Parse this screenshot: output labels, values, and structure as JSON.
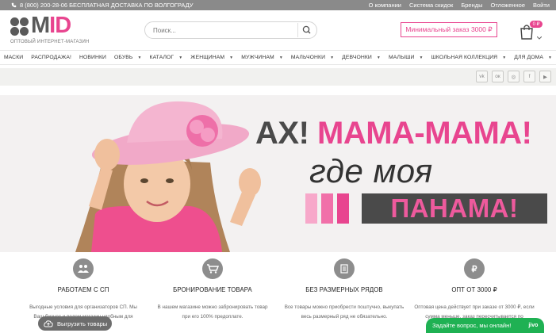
{
  "topbar": {
    "phone": "8 (800) 200-28-06 БЕСПЛАТНАЯ ДОСТАВКА ПО ВОЛГОГРАДУ",
    "links": [
      "О компании",
      "Система скидок",
      "Бренды",
      "Отложенное",
      "Войти"
    ]
  },
  "header": {
    "logo_word_main": "M",
    "logo_word_rest": "ID",
    "logo_sub": "ОПТОВЫЙ ИНТЕРНЕТ-МАГАЗИН",
    "search_placeholder": "Поиск...",
    "min_order": "Минимальный заказ 3000 ₽",
    "cart_badge": "0 ₽"
  },
  "nav": [
    {
      "label": "МАСКИ",
      "dropdown": false
    },
    {
      "label": "РАСПРОДАЖА!",
      "dropdown": false
    },
    {
      "label": "НОВИНКИ",
      "dropdown": false
    },
    {
      "label": "ОБУВЬ",
      "dropdown": true
    },
    {
      "label": "КАТАЛОГ",
      "dropdown": true
    },
    {
      "label": "ЖЕНЩИНАМ",
      "dropdown": true
    },
    {
      "label": "МУЖЧИНАМ",
      "dropdown": true
    },
    {
      "label": "МАЛЬЧОНКИ",
      "dropdown": true
    },
    {
      "label": "ДЕВЧОНКИ",
      "dropdown": true
    },
    {
      "label": "МАЛЫШИ",
      "dropdown": true
    },
    {
      "label": "ШКОЛЬНАЯ КОЛЛЕКЦИЯ",
      "dropdown": true
    },
    {
      "label": "ДЛЯ ДОМА",
      "dropdown": true
    }
  ],
  "social": [
    {
      "name": "vk-icon",
      "glyph": "vk"
    },
    {
      "name": "ok-icon",
      "glyph": "ок"
    },
    {
      "name": "instagram-icon",
      "glyph": "◎"
    },
    {
      "name": "facebook-icon",
      "glyph": "f"
    },
    {
      "name": "youtube-icon",
      "glyph": "▶"
    }
  ],
  "banner": {
    "line1_a": "АХ! ",
    "line1_b": "МАМА-МАМА!",
    "line2": "где моя",
    "line3": "ПАНАМА!"
  },
  "features": [
    {
      "icon": "people-icon",
      "title": "РАБОТАЕМ С СП",
      "text": "Выгодные условия для организаторов СП. Мы"
    },
    {
      "icon": "cart-icon",
      "title": "БРОНИРОВАНИЕ ТОВАРА",
      "text": "В нашем магазине можно забронировать товар",
      "text2": "при его 100% предоплате."
    },
    {
      "icon": "list-icon",
      "title": "БЕЗ РАЗМЕРНЫХ РЯДОВ",
      "text": "Все товары можно приобрести поштучно, выкупать",
      "text2": "весь размерный ряд не обязательно."
    },
    {
      "icon": "ruble-icon",
      "title": "ОПТ ОТ 3000 ₽",
      "text": "Оптовая цена действует при заказе от 3000 ₽, если",
      "text2": "сумма меньше, заказ пересчитывается по"
    }
  ],
  "feature1_text2": "Ваш бизнес и ведем магазин удобным для",
  "upload_button": "Выгрузить товары",
  "chat": {
    "label": "Задайте вопрос, мы онлайн!",
    "brand": "jivo"
  },
  "colors": {
    "accent": "#e8458f",
    "topbar": "#8a8a8a",
    "chat": "#1fb153"
  }
}
